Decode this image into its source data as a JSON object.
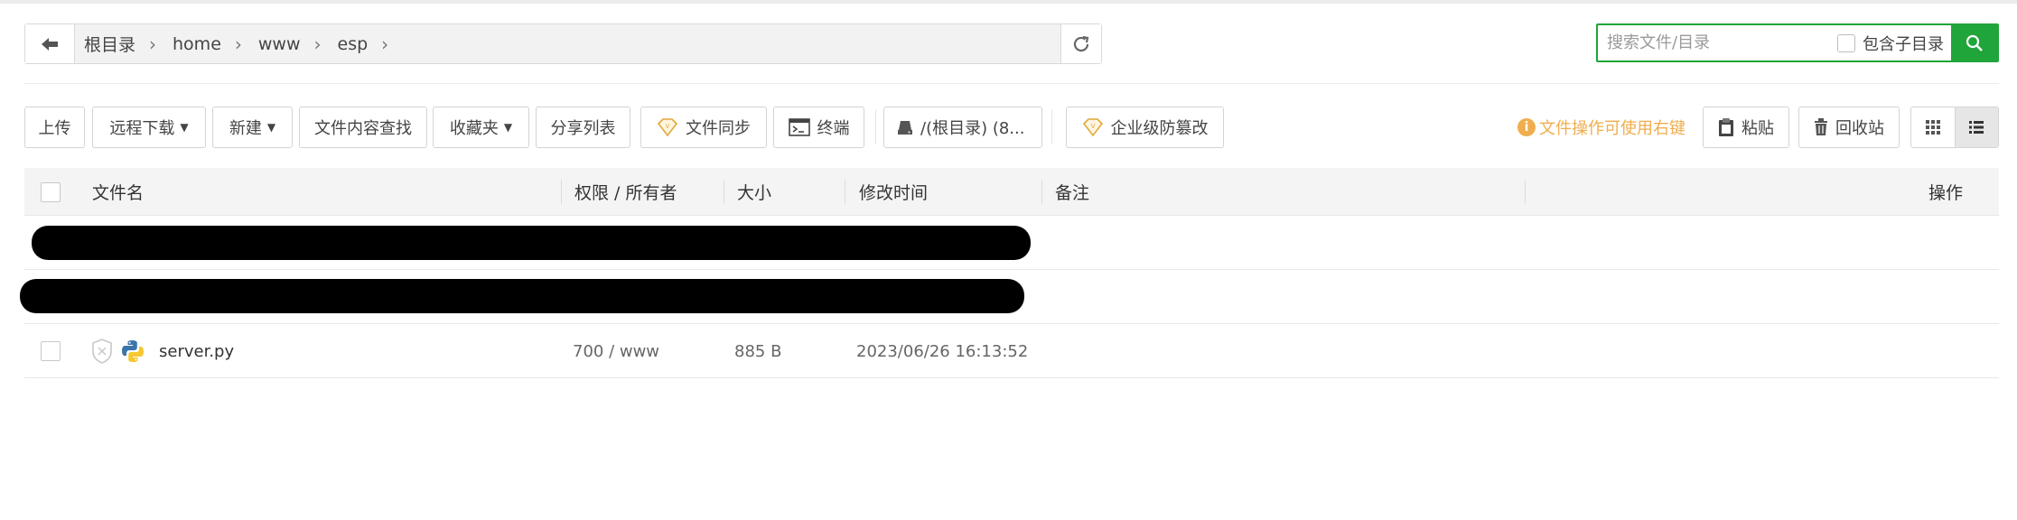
{
  "breadcrumb": {
    "items": [
      "根目录",
      "home",
      "www",
      "esp"
    ]
  },
  "search": {
    "placeholder": "搜索文件/目录",
    "include_subdir_label": "包含子目录"
  },
  "toolbar": {
    "upload": "上传",
    "remote_download": "远程下载",
    "new": "新建",
    "content_search": "文件内容查找",
    "favorites": "收藏夹",
    "share_list": "分享列表",
    "file_sync": "文件同步",
    "terminal": "终端",
    "disk": "/(根目录) (8...",
    "tamper_proof": "企业级防篡改",
    "tip": "文件操作可使用右键",
    "paste": "粘贴",
    "recycle_bin": "回收站"
  },
  "table": {
    "headers": {
      "name": "文件名",
      "permission_owner": "权限 / 所有者",
      "size": "大小",
      "modified": "修改时间",
      "remark": "备注",
      "actions": "操作"
    },
    "rows": [
      {
        "name": "server.py",
        "permission_owner": "700 / www",
        "size": "885 B",
        "modified": "2023/06/26 16:13:52",
        "icon": "python-file-icon"
      }
    ]
  },
  "colors": {
    "accent": "#20a53a",
    "tip": "#f0ad4e",
    "gold_icon": "#e0a73a"
  }
}
